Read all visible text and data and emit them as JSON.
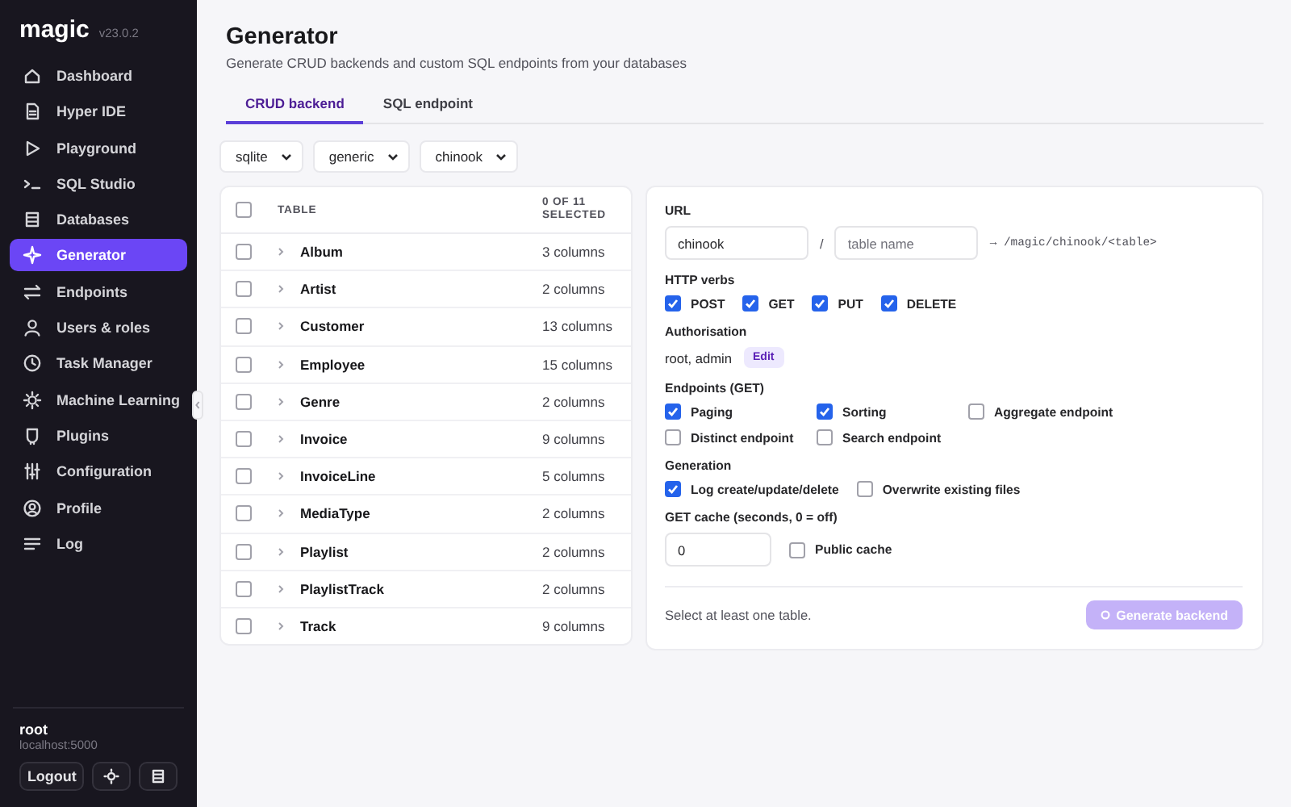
{
  "brand": {
    "name": "magic",
    "version": "v23.0.2"
  },
  "sidebar": {
    "items": [
      {
        "label": "Dashboard",
        "selected": false
      },
      {
        "label": "Hyper IDE",
        "selected": false
      },
      {
        "label": "Playground",
        "selected": false
      },
      {
        "label": "SQL Studio",
        "selected": false
      },
      {
        "label": "Databases",
        "selected": false
      },
      {
        "label": "Generator",
        "selected": true
      },
      {
        "label": "Endpoints",
        "selected": false
      },
      {
        "label": "Users & roles",
        "selected": false
      },
      {
        "label": "Task Manager",
        "selected": false
      },
      {
        "label": "Machine Learning",
        "selected": false
      },
      {
        "label": "Plugins",
        "selected": false
      },
      {
        "label": "Configuration",
        "selected": false
      },
      {
        "label": "Profile",
        "selected": false
      },
      {
        "label": "Log",
        "selected": false
      }
    ],
    "user": {
      "name": "root",
      "host": "localhost:5000"
    },
    "logout": "Logout"
  },
  "header": {
    "title": "Generator",
    "subtitle": "Generate CRUD backends and custom SQL endpoints from your databases"
  },
  "tabs": [
    {
      "label": "CRUD backend",
      "selected": true
    },
    {
      "label": "SQL endpoint",
      "selected": false
    }
  ],
  "selects": [
    {
      "value": "sqlite"
    },
    {
      "value": "generic"
    },
    {
      "value": "chinook"
    }
  ],
  "table": {
    "all_checked": false,
    "columns": [
      "TABLE",
      "0 OF 11 SELECTED"
    ],
    "rows": [
      {
        "name": "Album",
        "columns": "3 columns",
        "checked": false
      },
      {
        "name": "Artist",
        "columns": "2 columns",
        "checked": false
      },
      {
        "name": "Customer",
        "columns": "13 columns",
        "checked": false
      },
      {
        "name": "Employee",
        "columns": "15 columns",
        "checked": false
      },
      {
        "name": "Genre",
        "columns": "2 columns",
        "checked": false
      },
      {
        "name": "Invoice",
        "columns": "9 columns",
        "checked": false
      },
      {
        "name": "InvoiceLine",
        "columns": "5 columns",
        "checked": false
      },
      {
        "name": "MediaType",
        "columns": "2 columns",
        "checked": false
      },
      {
        "name": "Playlist",
        "columns": "2 columns",
        "checked": false
      },
      {
        "name": "PlaylistTrack",
        "columns": "2 columns",
        "checked": false
      },
      {
        "name": "Track",
        "columns": "9 columns",
        "checked": false
      }
    ]
  },
  "config": {
    "url": {
      "label": "URL",
      "database": "chinook",
      "separator": "/",
      "table_placeholder": "table name",
      "preview": "→ /magic/chinook/<table>"
    },
    "verbs": {
      "label": "HTTP verbs",
      "items": [
        {
          "label": "POST",
          "checked": true
        },
        {
          "label": "GET",
          "checked": true
        },
        {
          "label": "PUT",
          "checked": true
        },
        {
          "label": "DELETE",
          "checked": true
        }
      ]
    },
    "authorisation": {
      "label": "Authorisation",
      "value": "root, admin",
      "edit": "Edit"
    },
    "endpoints": {
      "label": "Endpoints (GET)",
      "items": [
        {
          "label": "Paging",
          "checked": true
        },
        {
          "label": "Sorting",
          "checked": true
        },
        {
          "label": "Aggregate endpoint",
          "checked": false
        },
        {
          "label": "Distinct endpoint",
          "checked": false
        },
        {
          "label": "Search endpoint",
          "checked": false
        }
      ]
    },
    "generation": {
      "label": "Generation",
      "items": [
        {
          "label": "Log create/update/delete",
          "checked": true
        },
        {
          "label": "Overwrite existing files",
          "checked": false
        }
      ]
    },
    "cache": {
      "label": "GET cache (seconds, 0 = off)",
      "value": "0",
      "items": [
        {
          "label": "Public cache",
          "checked": false
        }
      ]
    },
    "footer": {
      "hint": "Select at least one table.",
      "button": "Generate backend",
      "disabled": true
    }
  }
}
